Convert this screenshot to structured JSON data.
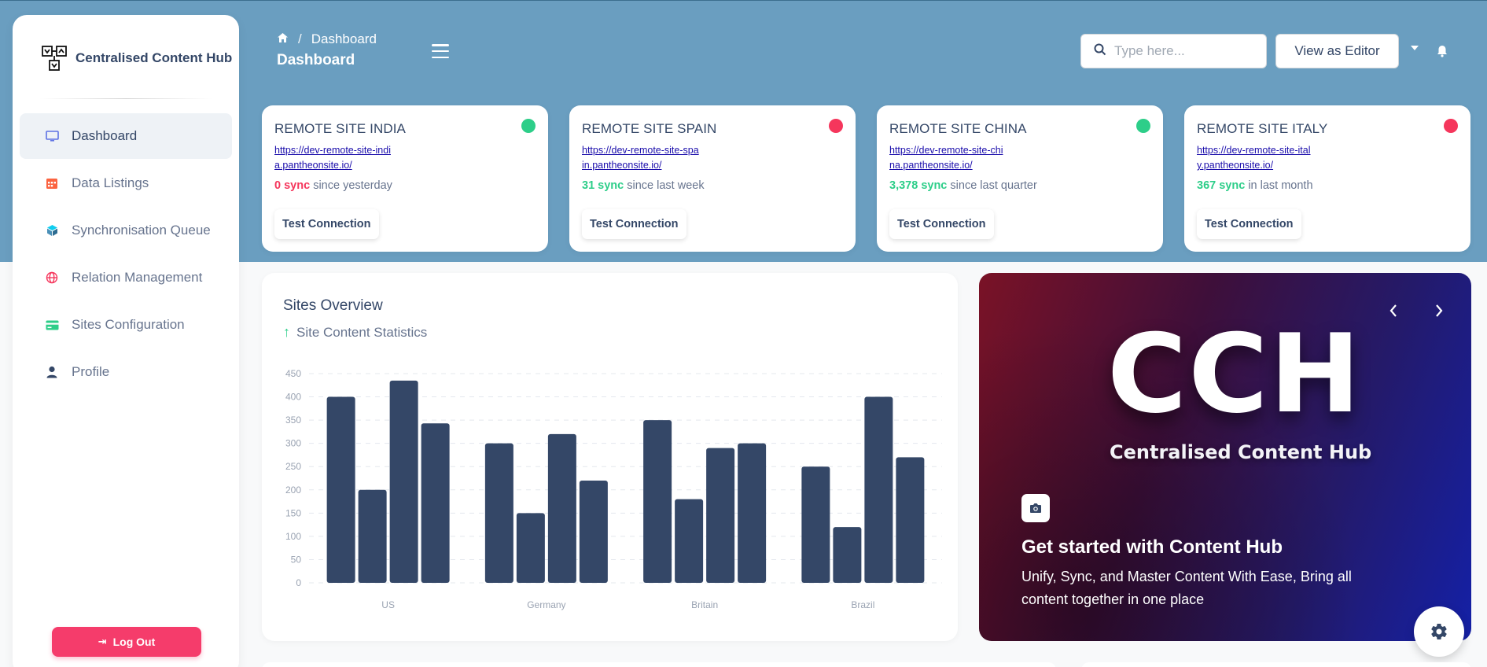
{
  "app": {
    "name": "Centralised Content Hub"
  },
  "sidebar": {
    "items": [
      {
        "label": "Dashboard",
        "icon": "monitor-icon",
        "active": true
      },
      {
        "label": "Data Listings",
        "icon": "calendar-icon",
        "active": false
      },
      {
        "label": "Synchronisation Queue",
        "icon": "cube-icon",
        "active": false
      },
      {
        "label": "Relation Management",
        "icon": "globe-icon",
        "active": false
      },
      {
        "label": "Sites Configuration",
        "icon": "card-icon",
        "active": false
      },
      {
        "label": "Profile",
        "icon": "user-icon",
        "active": false
      }
    ],
    "logout_label": "Log Out"
  },
  "header": {
    "breadcrumb_current": "Dashboard",
    "title": "Dashboard",
    "search_placeholder": "Type here...",
    "view_as_label": "View as Editor"
  },
  "sites": [
    {
      "title": "REMOTE SITE INDIA",
      "url": "https://dev-remote-site-india.pantheonsite.io/",
      "sync_count": "0 sync",
      "sync_period": "since yesterday",
      "status": "online",
      "status_color": "#2dce89",
      "count_color": "red",
      "button": "Test Connection"
    },
    {
      "title": "REMOTE SITE SPAIN",
      "url": "https://dev-remote-site-spain.pantheonsite.io/",
      "sync_count": "31 sync",
      "sync_period": "since last week",
      "status": "offline",
      "status_color": "#f5365c",
      "count_color": "green",
      "button": "Test Connection"
    },
    {
      "title": "REMOTE SITE CHINA",
      "url": "https://dev-remote-site-china.pantheonsite.io/",
      "sync_count": "3,378 sync",
      "sync_period": "since last quarter",
      "status": "online",
      "status_color": "#2dce89",
      "count_color": "green",
      "button": "Test Connection"
    },
    {
      "title": "REMOTE SITE ITALY",
      "url": "https://dev-remote-site-italy.pantheonsite.io/",
      "sync_count": "367 sync",
      "sync_period": "in last month",
      "status": "offline",
      "status_color": "#f5365c",
      "count_color": "green",
      "button": "Test Connection"
    }
  ],
  "overview": {
    "title": "Sites Overview",
    "subtitle": "Site Content Statistics"
  },
  "chart_data": {
    "type": "bar",
    "categories": [
      "US",
      "Germany",
      "Britain",
      "Brazil"
    ],
    "series": [
      {
        "values": [
          400,
          300,
          350,
          250
        ]
      },
      {
        "values": [
          200,
          150,
          180,
          120
        ]
      },
      {
        "values": [
          435,
          320,
          290,
          400
        ]
      },
      {
        "values": [
          343,
          220,
          300,
          270
        ]
      }
    ],
    "ylim": [
      0,
      450
    ],
    "yticks": [
      0,
      50,
      100,
      150,
      200,
      250,
      300,
      350,
      400,
      450
    ],
    "bar_color": "#344767",
    "grid": true
  },
  "hero": {
    "logo_text": "CCH",
    "logo_subtext": "Centralised Content Hub",
    "heading": "Get started with Content Hub",
    "text": "Unify, Sync, and Master Content With Ease, Bring all content together in one place"
  }
}
